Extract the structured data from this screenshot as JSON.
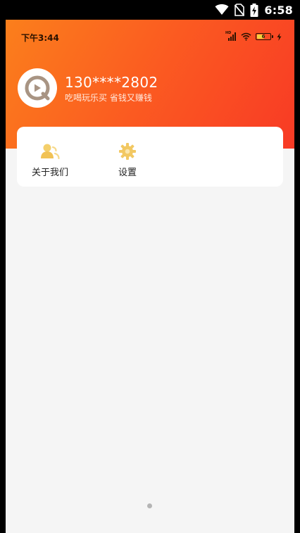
{
  "system_status": {
    "time": "6:58",
    "icons": [
      "wifi-icon",
      "no-sim-icon",
      "battery-charging-icon"
    ]
  },
  "app_status": {
    "time": "下午3:44",
    "hd_label": "HD",
    "battery_level": "6",
    "icons": [
      "signal-icon",
      "wifi-icon",
      "battery-icon",
      "charging-icon"
    ]
  },
  "profile": {
    "phone": "130****2802",
    "slogan": "吃喝玩乐买 省钱又赚钱",
    "avatar_icon": "app-logo-icon"
  },
  "menu": {
    "items": [
      {
        "label": "关于我们",
        "icon": "about-us-icon"
      },
      {
        "label": "设置",
        "icon": "settings-gear-icon"
      }
    ]
  },
  "colors": {
    "header_gradient_start": "#fb7f1c",
    "header_gradient_end": "#f83a25",
    "icon_gold": "#f3c95c",
    "page_background": "#f5f5f5"
  }
}
